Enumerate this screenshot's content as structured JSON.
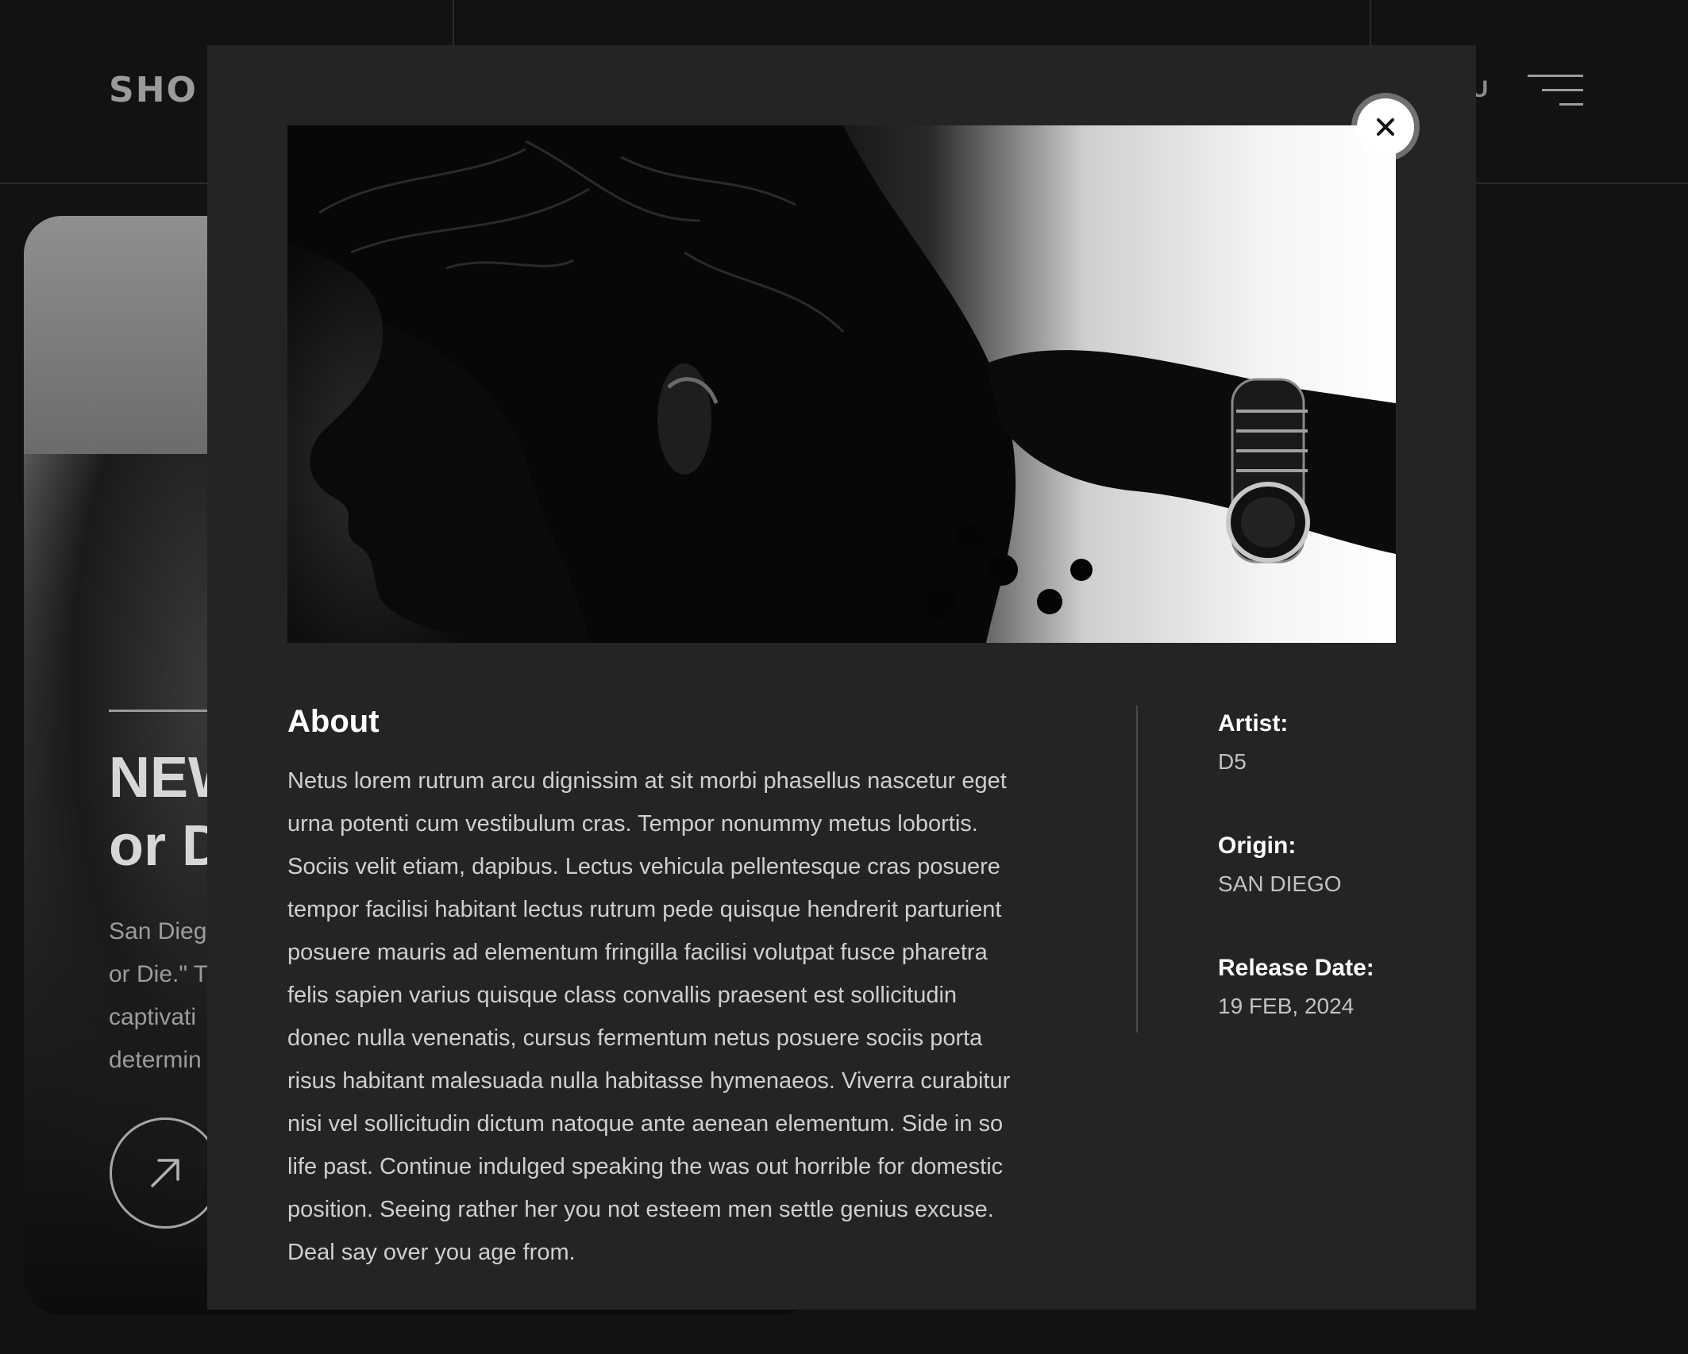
{
  "header": {
    "logo_text": "SHO",
    "menu_label": "NU"
  },
  "card": {
    "title_line1": "NEW",
    "title_line2": "or D",
    "desc_lines": [
      "San Dieg",
      "or Die.\" T",
      "captivati",
      "determin"
    ]
  },
  "modal": {
    "about_title": "About",
    "about_body": "Netus lorem rutrum arcu dignissim at sit morbi phasellus nascetur eget urna potenti cum vestibulum cras. Tempor nonummy metus lobortis. Sociis velit etiam, dapibus. Lectus vehicula pellentesque cras posuere tempor facilisi habitant lectus rutrum pede quisque hendrerit parturient posuere mauris ad elementum fringilla facilisi volutpat fusce pharetra felis sapien varius quisque class convallis praesent est sollicitudin donec nulla venenatis, cursus fermentum netus posuere sociis porta risus habitant malesuada nulla habitasse hymenaeos. Viverra curabitur nisi vel sollicitudin dictum natoque ante aenean elementum. Side in so life past. Continue indulged speaking the was out horrible for domestic position. Seeing rather her you not esteem men settle genius excuse. Deal say over you age from.",
    "meta": {
      "artist_label": "Artist:",
      "artist_value": "D5",
      "origin_label": "Origin:",
      "origin_value": "SAN DIEGO",
      "release_label": "Release Date:",
      "release_value": "19 FEB, 2024"
    }
  },
  "icons": {
    "close": "close-icon",
    "menu": "hamburger-menu-icon",
    "arrow": "arrow-up-right-icon"
  },
  "colors": {
    "page_bg": "#121213",
    "modal_bg": "#242425",
    "text_primary": "#ffffff",
    "text_body": "#cfcfcf"
  }
}
